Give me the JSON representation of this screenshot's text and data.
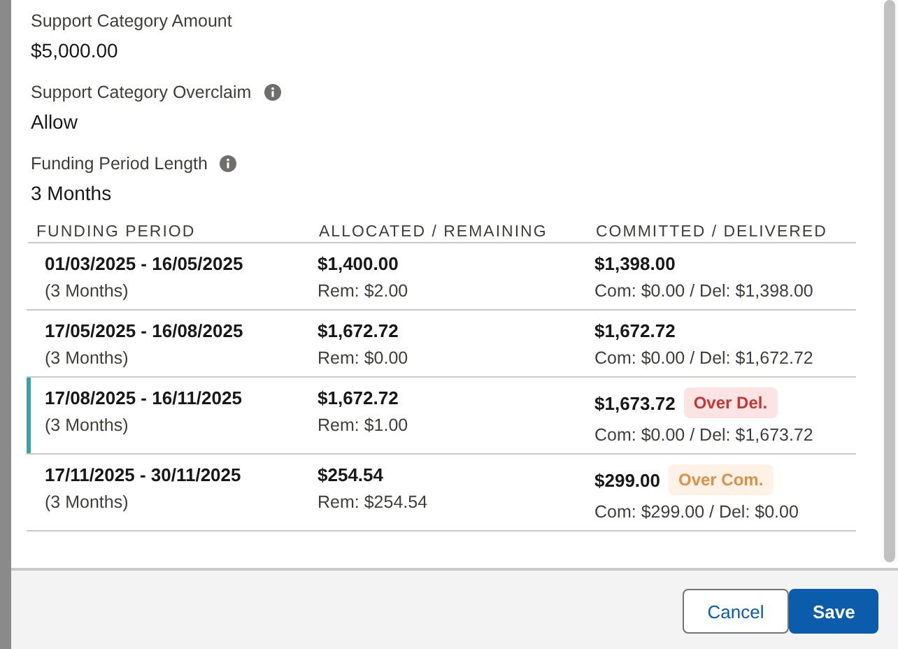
{
  "fields": [
    {
      "label": "Support Category Amount",
      "value": "$5,000.00",
      "info": false
    },
    {
      "label": "Support Category Overclaim",
      "value": "Allow",
      "info": true
    },
    {
      "label": "Funding Period Length",
      "value": "3 Months",
      "info": true
    }
  ],
  "table": {
    "columns": [
      "FUNDING PERIOD",
      "ALLOCATED / REMAINING",
      "COMMITTED / DELIVERED"
    ],
    "rows": [
      {
        "selected": false,
        "period": "01/03/2025 - 16/05/2025",
        "length": "(3 Months)",
        "allocated": "$1,400.00",
        "remaining": "Rem: $2.00",
        "committed": "$1,398.00",
        "breakdown": "Com: $0.00 / Del: $1,398.00"
      },
      {
        "selected": false,
        "period": "17/05/2025 - 16/08/2025",
        "length": "(3 Months)",
        "allocated": "$1,672.72",
        "remaining": "Rem: $0.00",
        "committed": "$1,672.72",
        "breakdown": "Com: $0.00 / Del: $1,672.72"
      },
      {
        "selected": true,
        "period": "17/08/2025 - 16/11/2025",
        "length": "(3 Months)",
        "allocated": "$1,672.72",
        "remaining": "Rem: $1.00",
        "committed": "$1,673.72",
        "badge": {
          "kind": "error",
          "text": "Over Del."
        },
        "breakdown": "Com: $0.00 / Del: $1,673.72"
      },
      {
        "selected": false,
        "period": "17/11/2025 - 30/11/2025",
        "length": "(3 Months)",
        "allocated": "$254.54",
        "remaining": "Rem: $254.54",
        "committed": "$299.00",
        "badge": {
          "kind": "warning",
          "text": "Over Com."
        },
        "breakdown": "Com: $299.00 / Del: $0.00"
      }
    ]
  },
  "buttons": [
    {
      "label": "Cancel",
      "kind": "neutral"
    },
    {
      "label": "Save",
      "kind": "brand"
    }
  ]
}
